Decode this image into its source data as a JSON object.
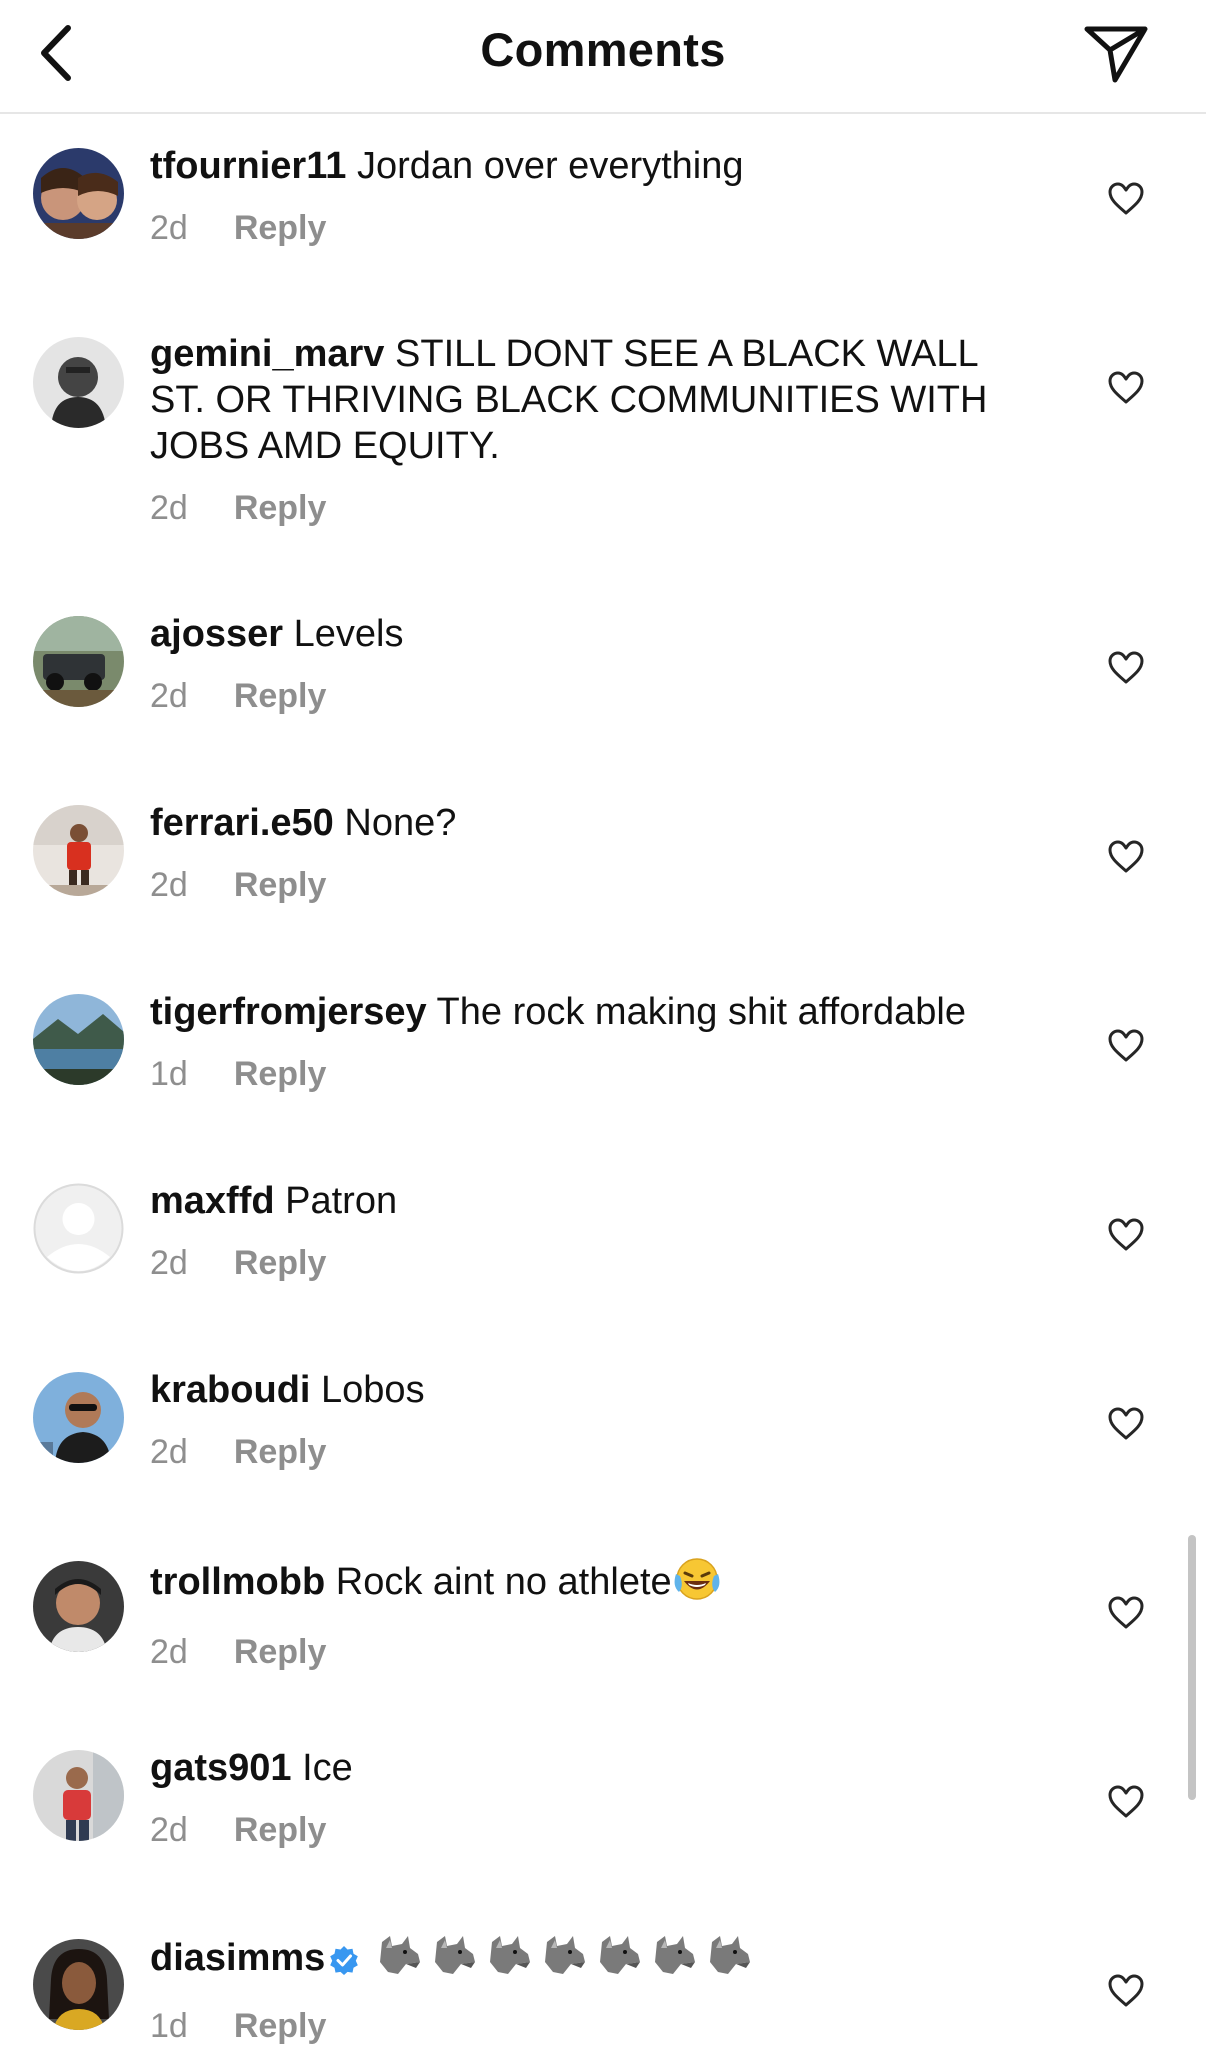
{
  "header": {
    "title": "Comments"
  },
  "comments": [
    {
      "username": "tfournier11",
      "text": "Jordan over everything",
      "time": "2d",
      "reply": "Reply"
    },
    {
      "username": "gemini_marv",
      "text": "STILL DONT SEE A BLACK WALL ST. OR THRIVING BLACK COMMUNITIES WITH JOBS AMD EQUITY.",
      "time": "2d",
      "reply": "Reply"
    },
    {
      "username": "ajosser",
      "text": "Levels",
      "time": "2d",
      "reply": "Reply"
    },
    {
      "username": "ferrari.e50",
      "text": "None?",
      "time": "2d",
      "reply": "Reply"
    },
    {
      "username": "tigerfromjersey",
      "text": "The rock making shit affordable",
      "time": "1d",
      "reply": "Reply"
    },
    {
      "username": "maxffd",
      "text": "Patron",
      "time": "2d",
      "reply": "Reply"
    },
    {
      "username": "kraboudi",
      "text": "Lobos",
      "time": "2d",
      "reply": "Reply"
    },
    {
      "username": "trollmobb",
      "text": "Rock aint no athlete",
      "time": "2d",
      "reply": "Reply",
      "emoji": "face-with-tears-of-joy"
    },
    {
      "username": "gats901",
      "text": "Ice",
      "time": "2d",
      "reply": "Reply"
    },
    {
      "username": "diasimms",
      "verified": true,
      "text": "",
      "time": "1d",
      "reply": "Reply",
      "emoji": "wolf x7"
    }
  ],
  "icons": {
    "back": "chevron-left-icon",
    "share": "send-icon",
    "like": "heart-outline-icon",
    "verified": "verified-badge-icon"
  },
  "colors": {
    "text": "#111111",
    "meta": "#8e8e8e",
    "verified": "#3897f0",
    "divider": "#e6e6e6"
  }
}
